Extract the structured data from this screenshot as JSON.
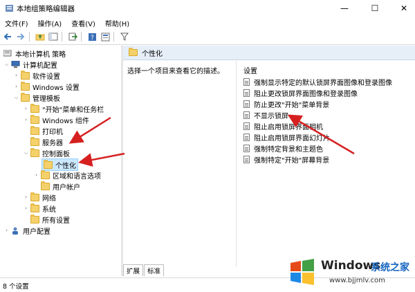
{
  "window": {
    "title": "本地组策略编辑器",
    "controls": {
      "minimize": "—",
      "maximize": "☐",
      "close": "✕"
    }
  },
  "menu": [
    "文件(F)",
    "操作(A)",
    "查看(V)",
    "帮助(H)"
  ],
  "tree": {
    "root": "本地计算机 策略",
    "computer_config": "计算机配置",
    "software": "软件设置",
    "windows_settings": "Windows 设置",
    "admin_templates": "管理模板",
    "start_menu": "\"开始\"菜单和任务栏",
    "windows_components": "Windows 组件",
    "printers": "打印机",
    "server": "服务器",
    "control_panel": "控制面板",
    "personalization": "个性化",
    "region_language": "区域和语言选项",
    "user_accounts": "用户帐户",
    "network": "网络",
    "system": "系统",
    "all_settings": "所有设置",
    "user_config": "用户配置"
  },
  "right": {
    "header": "个性化",
    "description": "选择一个项目来查看它的描述。",
    "settings_header": "设置",
    "settings": [
      "强制显示特定的默认锁屏界面图像和登录图像",
      "阻止更改锁屏界面图像和登录图像",
      "防止更改\"开始\"菜单背景",
      "不显示锁屏",
      "阻止启用锁屏界面相机",
      "阻止启用锁屏界面幻灯片",
      "强制特定背景和主题色",
      "强制特定\"开始\"屏幕背景"
    ],
    "tabs": [
      "扩展",
      "标准"
    ]
  },
  "status": "8 个设置",
  "watermark": {
    "brand": "Windows",
    "cn": "系统之家",
    "url": "www.bjjmlv.com"
  },
  "colors": {
    "arrow": "#d62020",
    "selection": "#cce8ff",
    "header": "#e6eef8"
  }
}
